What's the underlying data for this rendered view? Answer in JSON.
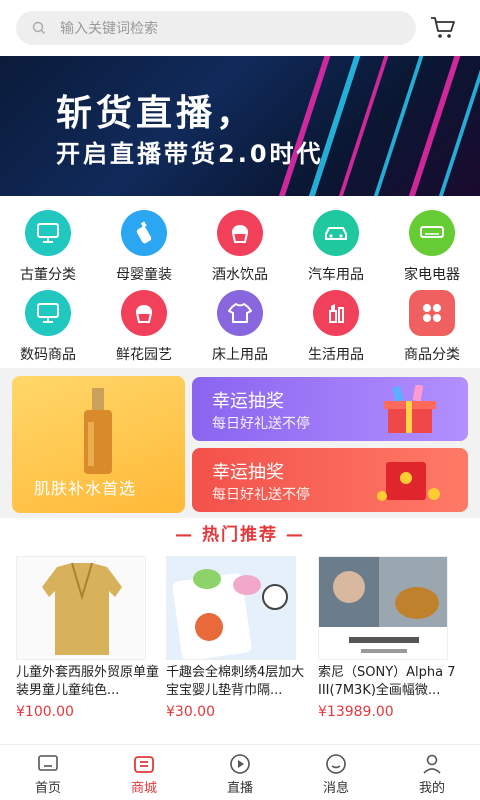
{
  "search": {
    "placeholder": "输入关键词检索"
  },
  "banner": {
    "line1": "斩货直播，",
    "line2": "开启直播带货2.0时代"
  },
  "categories": [
    {
      "label": "古董分类",
      "icon": "monitor-icon",
      "color": "#20c8c0"
    },
    {
      "label": "母婴童装",
      "icon": "bottle-icon",
      "color": "#2aa6f3"
    },
    {
      "label": "酒水饮品",
      "icon": "cupcake-icon",
      "color": "#f0405a"
    },
    {
      "label": "汽车用品",
      "icon": "car-icon",
      "color": "#20c8a0"
    },
    {
      "label": "家电电器",
      "icon": "air-conditioner-icon",
      "color": "#66cc33"
    },
    {
      "label": "数码商品",
      "icon": "monitor-icon",
      "color": "#20c8c0"
    },
    {
      "label": "鲜花园艺",
      "icon": "cupcake-icon",
      "color": "#f0405a"
    },
    {
      "label": "床上用品",
      "icon": "shirt-icon",
      "color": "#8866dd"
    },
    {
      "label": "生活用品",
      "icon": "lipstick-icon",
      "color": "#f0405a"
    },
    {
      "label": "商品分类",
      "icon": "grid-icon",
      "color": "#f06060"
    }
  ],
  "promo": {
    "left_text": "肌肤补水首选",
    "right": [
      {
        "title": "幸运抽奖",
        "sub": "每日好礼送不停"
      },
      {
        "title": "幸运抽奖",
        "sub": "每日好礼送不停"
      }
    ]
  },
  "section_title": "— 热门推荐 —",
  "products": [
    {
      "name": "儿童外套西服外贸原单童装男童儿童纯色...",
      "price": "¥100.00"
    },
    {
      "name": "千趣会全棉刺绣4层加大宝宝婴儿垫背巾隔...",
      "price": "¥30.00"
    },
    {
      "name": "索尼（SONY）Alpha 7 III(7M3K)全画幅微...",
      "price": "¥13989.00"
    }
  ],
  "tabbar": [
    {
      "label": "首页",
      "icon": "home-icon",
      "active": false
    },
    {
      "label": "商城",
      "icon": "shop-icon",
      "active": true
    },
    {
      "label": "直播",
      "icon": "play-icon",
      "active": false
    },
    {
      "label": "消息",
      "icon": "message-icon",
      "active": false
    },
    {
      "label": "我的",
      "icon": "user-icon",
      "active": false
    }
  ],
  "colors": {
    "accent": "#e4393c",
    "promo_purple": "#8b6cf3",
    "promo_red": "#f2534e"
  }
}
